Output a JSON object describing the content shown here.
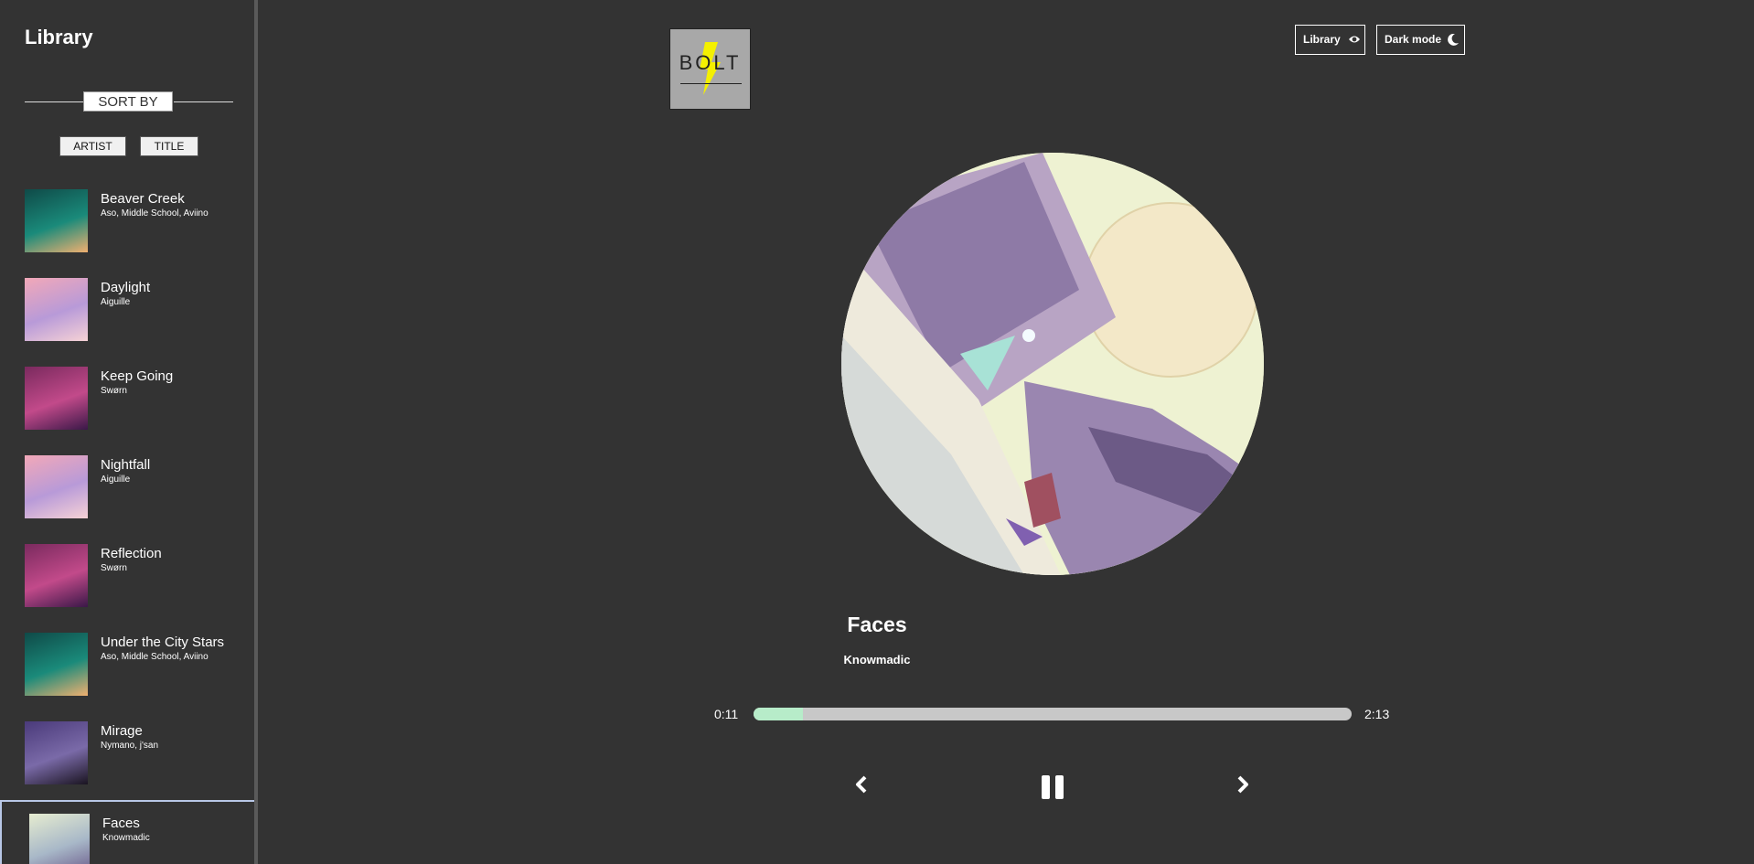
{
  "sidebar": {
    "title": "Library",
    "sort_label": "SORT BY",
    "sort_buttons": {
      "artist": "ARTIST",
      "title": "TITLE"
    },
    "songs": [
      {
        "title": "Beaver Creek",
        "artist": "Aso, Middle School, Aviino",
        "cover_colors": [
          "#0f4a48",
          "#1a8a7a",
          "#f0b070"
        ]
      },
      {
        "title": "Daylight",
        "artist": "Aiguille",
        "cover_colors": [
          "#f2a8b8",
          "#b89ad8",
          "#f6d2d6"
        ]
      },
      {
        "title": "Keep Going",
        "artist": "Swørn",
        "cover_colors": [
          "#7a2a5e",
          "#c24a8a",
          "#3a1848"
        ]
      },
      {
        "title": "Nightfall",
        "artist": "Aiguille",
        "cover_colors": [
          "#f2a8b8",
          "#b89ad8",
          "#f6d2d6"
        ]
      },
      {
        "title": "Reflection",
        "artist": "Swørn",
        "cover_colors": [
          "#7a2a5e",
          "#c24a8a",
          "#3a1848"
        ]
      },
      {
        "title": "Under the City Stars",
        "artist": "Aso, Middle School, Aviino",
        "cover_colors": [
          "#0f4a48",
          "#1a8a7a",
          "#f0b070"
        ]
      },
      {
        "title": "Mirage",
        "artist": "Nymano, j'san",
        "cover_colors": [
          "#4a3a7a",
          "#7a6aa8",
          "#1a1420"
        ]
      },
      {
        "title": "Faces",
        "artist": "Knowmadic",
        "cover_colors": [
          "#e6ecd0",
          "#a8b8c8",
          "#6a5a8a"
        ]
      }
    ],
    "active_song_index": 7
  },
  "header": {
    "logo_text": "BOLT",
    "library_button": "Library",
    "library_icon": "eye-icon",
    "dark_mode_button": "Dark mode",
    "dark_mode_icon": "moon-icon"
  },
  "now_playing": {
    "title": "Faces",
    "artist": "Knowmadic",
    "current_time": "0:11",
    "total_time": "2:13",
    "progress_fraction": 0.083
  },
  "controls": {
    "prev_icon": "chevron-left-icon",
    "play_icon": "pause-icon",
    "next_icon": "chevron-right-icon"
  },
  "colors": {
    "background": "#333333",
    "progress_fill": "#b7ecc9",
    "progress_track": "#c8c8c8",
    "logo_bolt": "#f4f000",
    "active_border": "#b8c7e6"
  }
}
